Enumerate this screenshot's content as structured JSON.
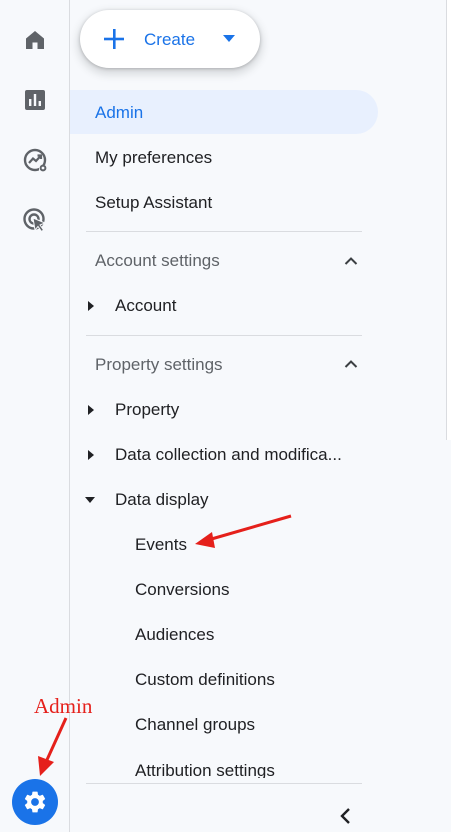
{
  "create": {
    "label": "Create"
  },
  "nav": {
    "admin": "Admin",
    "preferences": "My preferences",
    "setup_assistant": "Setup Assistant"
  },
  "account_settings": {
    "heading": "Account settings",
    "items": [
      "Account"
    ]
  },
  "property_settings": {
    "heading": "Property settings",
    "property": "Property",
    "data_collection": "Data collection and modifica...",
    "data_display": {
      "label": "Data display",
      "children": [
        "Events",
        "Conversions",
        "Audiences",
        "Custom definitions",
        "Channel groups",
        "Attribution settings"
      ]
    }
  },
  "annotation": {
    "label": "Admin"
  },
  "colors": {
    "accent": "#1a73e8",
    "active_bg": "#e8f0fe",
    "annotation": "#e5201b"
  },
  "icons": [
    "home-icon",
    "reports-icon",
    "explore-icon",
    "advertising-icon",
    "gear-icon",
    "chevron-left-icon"
  ]
}
